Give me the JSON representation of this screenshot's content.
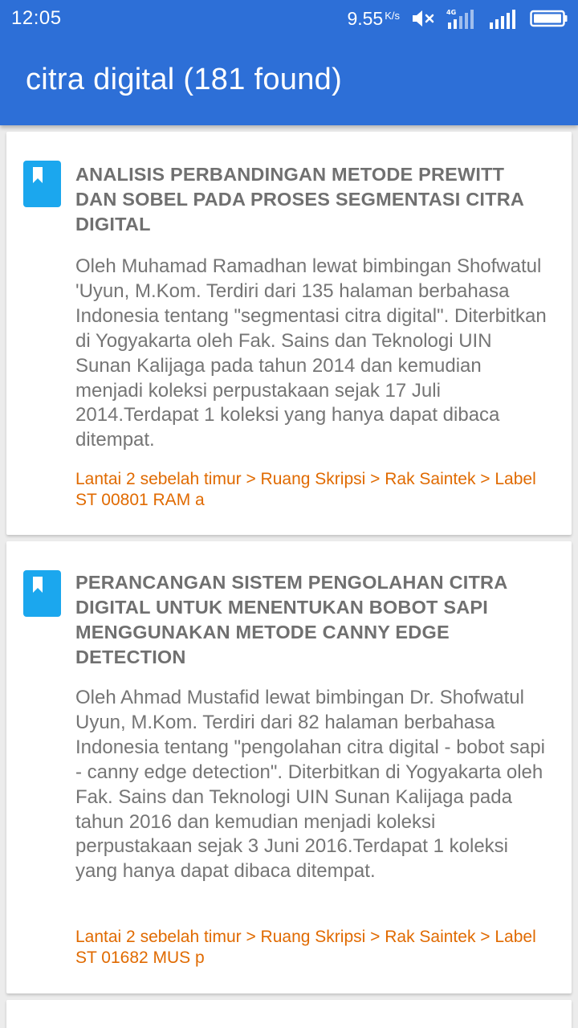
{
  "status_bar": {
    "time": "12:05",
    "net_speed": "9.55",
    "net_speed_unit": "K/s",
    "icons": [
      "mute-icon",
      "signal-4g-icon",
      "signal-icon",
      "battery-icon"
    ]
  },
  "app_bar": {
    "title": "citra digital (181 found)"
  },
  "colors": {
    "primary": "#2d6fd7",
    "bookmark": "#1ba7ee",
    "location_text": "#e06a00",
    "background": "#ececec"
  },
  "results": [
    {
      "icon": "bookmark-icon",
      "title": "ANALISIS PERBANDINGAN METODE PREWITT DAN SOBEL PADA PROSES SEGMENTASI CITRA DIGITAL",
      "description": "Oleh Muhamad Ramadhan lewat bimbingan Shofwatul 'Uyun, M.Kom. Terdiri dari 135 halaman berbahasa Indonesia tentang \"segmentasi citra digital\". Diterbitkan di Yogyakarta oleh Fak. Sains dan Teknologi UIN Sunan Kalijaga  pada tahun 2014 dan kemudian menjadi koleksi perpustakaan sejak 17 Juli 2014.Terdapat 1 koleksi yang hanya dapat dibaca ditempat.",
      "location": "Lantai 2 sebelah timur > Ruang Skripsi > Rak Saintek  > Label ST 00801 RAM a"
    },
    {
      "icon": "bookmark-icon",
      "title": "PERANCANGAN SISTEM PENGOLAHAN CITRA DIGITAL UNTUK MENENTUKAN BOBOT SAPI MENGGUNAKAN METODE CANNY EDGE DETECTION",
      "description": "Oleh Ahmad Mustafid lewat bimbingan Dr. Shofwatul Uyun, M.Kom. Terdiri dari 82 halaman berbahasa Indonesia tentang \"pengolahan citra digital - bobot sapi - canny edge detection\". Diterbitkan di Yogyakarta oleh Fak. Sains dan Teknologi UIN Sunan Kalijaga pada tahun 2016 dan kemudian menjadi koleksi perpustakaan sejak 3 Juni 2016.Terdapat 1 koleksi yang hanya dapat dibaca ditempat.",
      "location": "Lantai 2 sebelah timur > Ruang Skripsi > Rak Saintek  > Label ST 01682 MUS p"
    }
  ]
}
